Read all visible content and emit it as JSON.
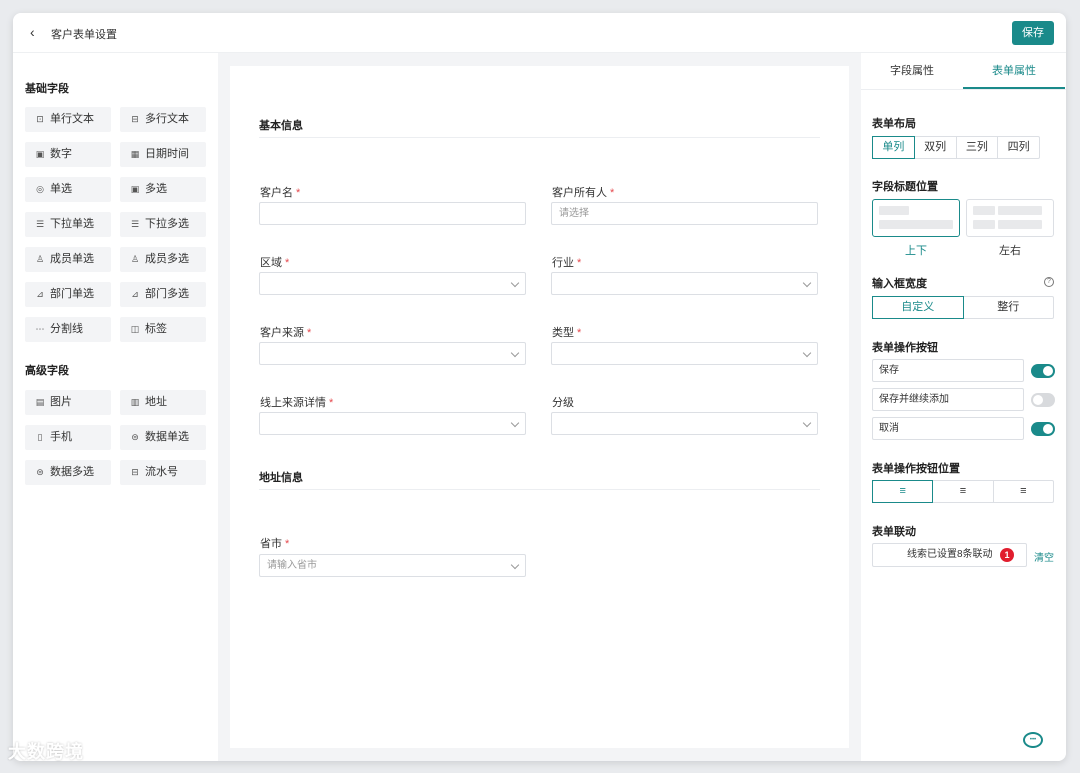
{
  "header": {
    "title": "客户表单设置",
    "save_label": "保存"
  },
  "left": {
    "basic_title": "基础字段",
    "basic_fields": [
      {
        "label": "单行文本",
        "icon": "single-line-text-icon",
        "glyph": "⊡"
      },
      {
        "label": "多行文本",
        "icon": "multi-line-text-icon",
        "glyph": "⊟"
      },
      {
        "label": "数字",
        "icon": "number-icon",
        "glyph": "▣"
      },
      {
        "label": "日期时间",
        "icon": "calendar-icon",
        "glyph": "▦"
      },
      {
        "label": "单选",
        "icon": "radio-icon",
        "glyph": "◎"
      },
      {
        "label": "多选",
        "icon": "checkbox-icon",
        "glyph": "▣"
      },
      {
        "label": "下拉单选",
        "icon": "dropdown-list-icon",
        "glyph": "☰"
      },
      {
        "label": "下拉多选",
        "icon": "dropdown-multi-icon",
        "glyph": "☰"
      },
      {
        "label": "成员单选",
        "icon": "member-icon",
        "glyph": "♙"
      },
      {
        "label": "成员多选",
        "icon": "members-icon",
        "glyph": "♙"
      },
      {
        "label": "部门单选",
        "icon": "department-icon",
        "glyph": "⊿"
      },
      {
        "label": "部门多选",
        "icon": "departments-icon",
        "glyph": "⊿"
      },
      {
        "label": "分割线",
        "icon": "divider-icon",
        "glyph": "⋯"
      },
      {
        "label": "标签",
        "icon": "tag-icon",
        "glyph": "◫"
      }
    ],
    "advanced_title": "高级字段",
    "advanced_fields": [
      {
        "label": "图片",
        "icon": "image-icon",
        "glyph": "▤"
      },
      {
        "label": "地址",
        "icon": "map-icon",
        "glyph": "▥"
      },
      {
        "label": "手机",
        "icon": "phone-icon",
        "glyph": "▯"
      },
      {
        "label": "数据单选",
        "icon": "data-single-icon",
        "glyph": "⊜"
      },
      {
        "label": "数据多选",
        "icon": "data-multi-icon",
        "glyph": "⊜"
      },
      {
        "label": "流水号",
        "icon": "serial-number-icon",
        "glyph": "⊟"
      }
    ]
  },
  "form": {
    "basic_title": "基本信息",
    "customer_name_label": "客户名",
    "owner_label": "客户所有人",
    "owner_placeholder": "请选择",
    "region_label": "区域",
    "industry_label": "行业",
    "source_label": "客户来源",
    "type_label": "类型",
    "online_source_label": "线上来源详情",
    "grade_label": "分级",
    "address_title": "地址信息",
    "province_label": "省市",
    "province_placeholder": "请输入省市",
    "required_mark": "*"
  },
  "right": {
    "tabs": [
      "字段属性",
      "表单属性"
    ],
    "layout_title": "表单布局",
    "layout_options": [
      "单列",
      "双列",
      "三列",
      "四列"
    ],
    "label_pos_title": "字段标题位置",
    "label_pos_options": [
      "上下",
      "左右"
    ],
    "width_title": "输入框宽度",
    "help_glyph": "?",
    "width_options": [
      "自定义",
      "整行"
    ],
    "actions_title": "表单操作按钮",
    "actions": [
      {
        "label": "保存",
        "enabled": true
      },
      {
        "label": "保存并继续添加",
        "enabled": false
      },
      {
        "label": "取消",
        "enabled": true
      }
    ],
    "align_title": "表单操作按钮位置",
    "align_glyphs": [
      "≡",
      "≡",
      "≡"
    ],
    "linkage_title": "表单联动",
    "linkage_text": "线索已设置8条联动",
    "linkage_count": "1",
    "clear_label": "清空"
  },
  "colors": {
    "accent": "#1a8a8a",
    "required": "#e5484d",
    "badge": "#e11d2e"
  },
  "watermark": "大数跨境"
}
